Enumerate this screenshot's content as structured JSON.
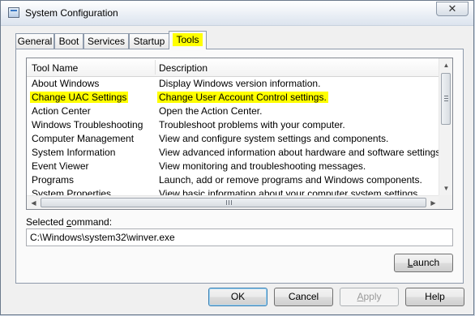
{
  "window": {
    "title": "System Configuration",
    "close_glyph": "✕"
  },
  "tabs": [
    {
      "label": "General"
    },
    {
      "label": "Boot"
    },
    {
      "label": "Services"
    },
    {
      "label": "Startup"
    },
    {
      "label": "Tools",
      "active": true
    }
  ],
  "table": {
    "columns": [
      "Tool Name",
      "Description"
    ],
    "rows": [
      {
        "name": "About Windows",
        "description": "Display Windows version information.",
        "highlighted": false
      },
      {
        "name": "Change UAC Settings",
        "description": "Change User Account Control settings.",
        "highlighted": true
      },
      {
        "name": "Action Center",
        "description": "Open the Action Center.",
        "highlighted": false
      },
      {
        "name": "Windows Troubleshooting",
        "description": "Troubleshoot problems with your computer.",
        "highlighted": false
      },
      {
        "name": "Computer Management",
        "description": "View and configure system settings and components.",
        "highlighted": false
      },
      {
        "name": "System Information",
        "description": "View advanced information about hardware and software settings.",
        "highlighted": false
      },
      {
        "name": "Event Viewer",
        "description": "View monitoring and troubleshooting messages.",
        "highlighted": false
      },
      {
        "name": "Programs",
        "description": "Launch, add or remove programs and Windows components.",
        "highlighted": false
      },
      {
        "name": "System Properties",
        "description": "View basic information about your computer system settings.",
        "highlighted": false
      }
    ]
  },
  "selected_command": {
    "label_prefix": "Selected ",
    "label_access_key": "c",
    "label_suffix": "ommand:",
    "value": "C:\\Windows\\system32\\winver.exe"
  },
  "buttons": {
    "launch": {
      "access_key": "L",
      "rest": "aunch"
    },
    "ok": "OK",
    "cancel": "Cancel",
    "apply": {
      "access_key": "A",
      "rest": "pply"
    },
    "help": "Help"
  },
  "colors": {
    "highlight": "#ffff00",
    "window_bg": "#f0f0f0"
  }
}
